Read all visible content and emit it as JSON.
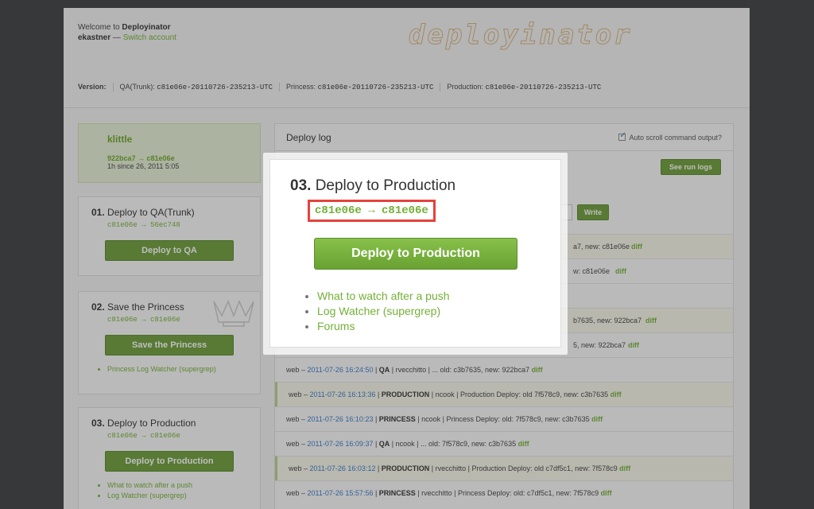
{
  "header": {
    "welcome_prefix": "Welcome to",
    "app_name": "Deployinator",
    "user": "ekastner",
    "switch_sep": " — ",
    "switch_account": "Switch account",
    "logo_text": "deployinator"
  },
  "versions": {
    "label": "Version:",
    "items": [
      {
        "name": "QA(Trunk):",
        "value": "c81e06e-20110726-235213-UTC"
      },
      {
        "name": "Princess:",
        "value": "c81e06e-20110726-235213-UTC"
      },
      {
        "name": "Production:",
        "value": "c81e06e-20110726-235213-UTC"
      }
    ]
  },
  "userbox": {
    "name": "klittle",
    "commit": "922bca7 → c81e06e",
    "since": "1h since 26, 2011 5:05"
  },
  "steps": [
    {
      "num": "01.",
      "title": "Deploy to QA(Trunk)",
      "hash": "c81e06e → 56ec748",
      "button": "Deploy to QA",
      "links": []
    },
    {
      "num": "02.",
      "title": "Save the Princess",
      "hash": "c81e06e → c81e06e",
      "button": "Save the Princess",
      "links": [
        "Princess Log Watcher (supergrep)"
      ]
    },
    {
      "num": "03.",
      "title": "Deploy to Production",
      "hash": "c81e06e → c81e06e",
      "button": "Deploy to Production",
      "links": [
        "What to watch after a push",
        "Log Watcher (supergrep)"
      ]
    }
  ],
  "log": {
    "title": "Deploy log",
    "autoscroll": "Auto scroll command output?",
    "run_logs": "See run logs",
    "write": "Write",
    "partial_rows": [
      {
        "text": "a7, new: c81e06e",
        "diff": "diff"
      },
      {
        "text": "w: c81e06e",
        "diff": "diff"
      },
      {
        "text": "b7635, new: 922bca7",
        "diff": "diff"
      },
      {
        "text": "5, new: 922bca7",
        "diff": "diff"
      }
    ],
    "rows": [
      {
        "prefix": "web –",
        "ts": "2011-07-26 16:24:50",
        "env": "QA",
        "rest": " | rvecchitto | ... old: c3b7635, new: 922bca7",
        "diff": "diff",
        "prod": false
      },
      {
        "prefix": "web –",
        "ts": "2011-07-26 16:13:36",
        "env": "PRODUCTION",
        "rest": " | ncook | Production Deploy: old 7f578c9, new: c3b7635",
        "diff": "diff",
        "prod": true
      },
      {
        "prefix": "web –",
        "ts": "2011-07-26 16:10:23",
        "env": "PRINCESS",
        "rest": " | ncook | Princess Deploy: old: 7f578c9, new: c3b7635",
        "diff": "diff",
        "prod": false
      },
      {
        "prefix": "web –",
        "ts": "2011-07-26 16:09:37",
        "env": "QA",
        "rest": " | ncook | ... old: 7f578c9, new: c3b7635",
        "diff": "diff",
        "prod": false
      },
      {
        "prefix": "web –",
        "ts": "2011-07-26 16:03:12",
        "env": "PRODUCTION",
        "rest": " | rvecchitto | Production Deploy: old c7df5c1, new: 7f578c9",
        "diff": "diff",
        "prod": true
      },
      {
        "prefix": "web –",
        "ts": "2011-07-26 15:57:56",
        "env": "PRINCESS",
        "rest": " | rvecchitto | Princess Deploy: old: c7df5c1, new: 7f578c9",
        "diff": "diff",
        "prod": false
      }
    ]
  },
  "modal": {
    "num": "03.",
    "title": "Deploy to Production",
    "hash": "c81e06e → c81e06e",
    "button": "Deploy to Production",
    "links": [
      "What to watch after a push",
      "Log Watcher (supergrep)",
      "Forums"
    ]
  },
  "colors": {
    "accent_green": "#74b037",
    "highlight_red": "#e4433b",
    "timestamp_blue": "#3a7ac8"
  }
}
